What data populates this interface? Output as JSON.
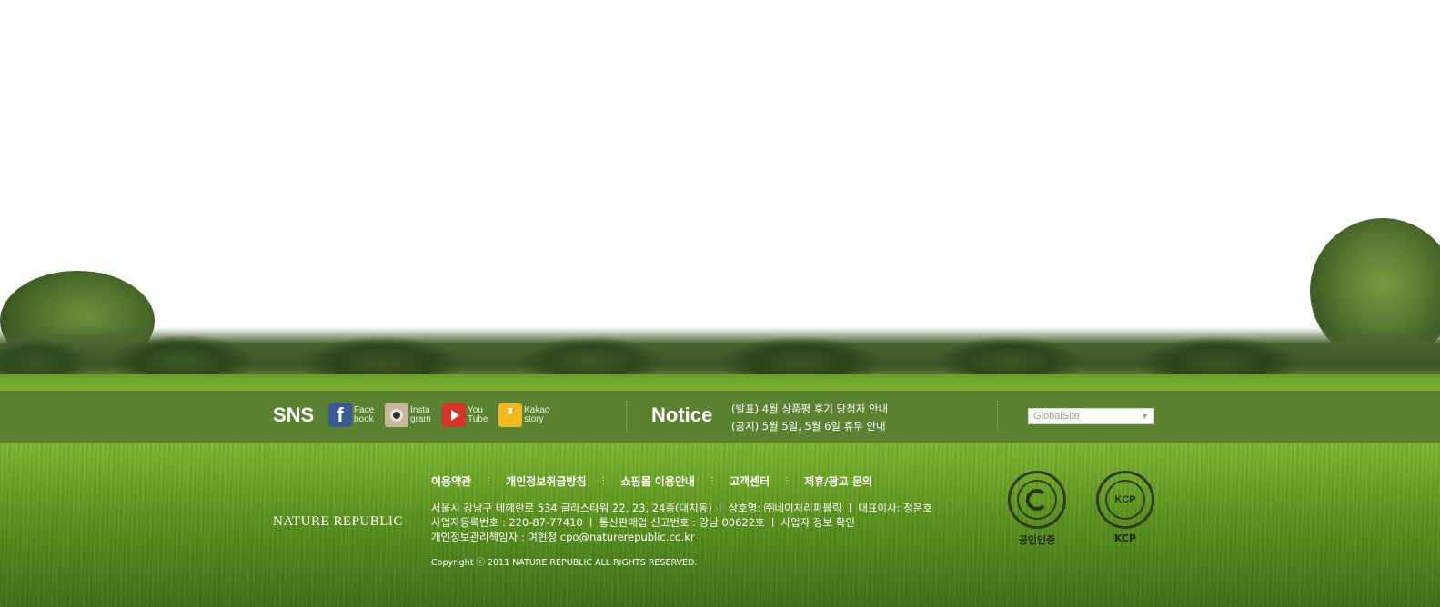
{
  "sns": {
    "title": "SNS",
    "items": [
      {
        "line1": "Face",
        "line2": "book",
        "icon": "facebook-icon"
      },
      {
        "line1": "Insta",
        "line2": "gram",
        "icon": "instagram-icon"
      },
      {
        "line1": "You",
        "line2": "Tube",
        "icon": "youtube-icon"
      },
      {
        "line1": "Kakao",
        "line2": "story",
        "icon": "kakaostory-icon"
      }
    ]
  },
  "notice": {
    "title": "Notice",
    "items": [
      "(발표) 4월 상품평 후기 당첨자 안내",
      "(공지) 5월 5일, 5월 6일 휴무 안내"
    ]
  },
  "global_site": {
    "selected": "GlobalSite"
  },
  "footer": {
    "links": [
      "이용약관",
      "개인정보취급방침",
      "쇼핑몰 이용안내",
      "고객센터",
      "제휴/광고 문의"
    ],
    "brand": "NATURE REPUBLIC",
    "info_lines": [
      "서울시 강남구 테헤란로 534 글라스타워 22, 23, 24층(대치동) ㅣ 상호명: ㈜네이처리퍼블릭 ㅣ 대표이사: 정운호",
      "사업자등록번호 : 220-87-77410 ㅣ 통신판매업 신고번호 : 강남 00622호 ㅣ 사업자 정보 확인",
      "개인정보관리책임자 : 여현정 cpo@naturerepublic.co.kr"
    ],
    "copyright": "Copyright ⓒ 2011 NATURE REPUBLIC ALL RIGHTS RESERVED."
  },
  "badges": [
    {
      "label": "공인인증",
      "icon": "certification-seal-icon"
    },
    {
      "label": "KCP",
      "icon": "kcp-seal-icon",
      "mark": "KCP"
    }
  ],
  "colors": {
    "band": "#5b8231",
    "grass": "#5d9420"
  }
}
